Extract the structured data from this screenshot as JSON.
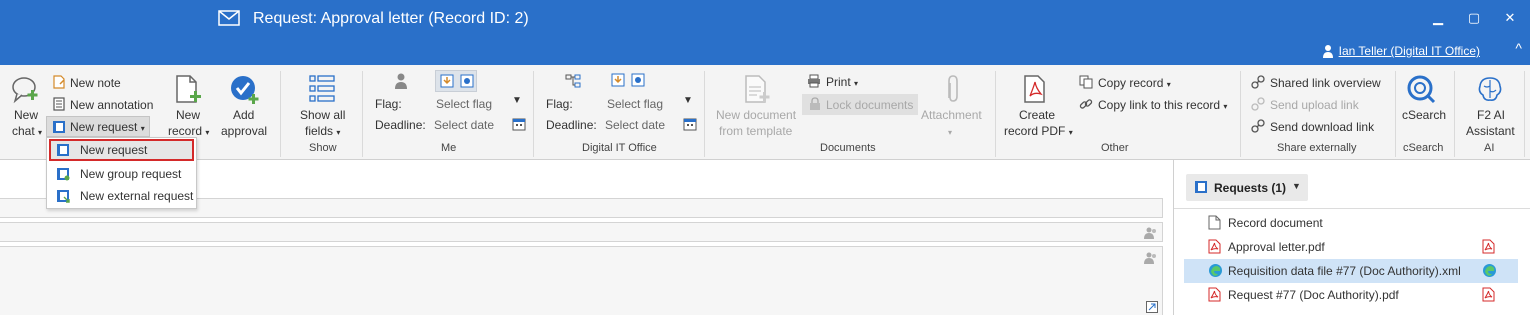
{
  "window": {
    "title": "Request: Approval letter (Record ID: 2)",
    "minimize": "▁",
    "maximize": "▢",
    "close": "✕",
    "user_link": "Ian Teller (Digital IT Office)",
    "collapse_ribbon": "^"
  },
  "ribbon": {
    "new_chat": {
      "line1": "New",
      "line2": "chat"
    },
    "new_note": "New note",
    "new_annotation": "New annotation",
    "new_request": "New request",
    "new_record": {
      "line1": "New",
      "line2": "record"
    },
    "add_approval": {
      "line1": "Add",
      "line2": "approval"
    },
    "show_all_fields": {
      "line1": "Show all",
      "line2": "fields"
    },
    "show_group": "Show",
    "me": {
      "flag_label": "Flag:",
      "flag_value": "Select flag",
      "deadline_label": "Deadline:",
      "deadline_value": "Select date",
      "group": "Me"
    },
    "digital_it_office": {
      "flag_label": "Flag:",
      "flag_value": "Select flag",
      "deadline_label": "Deadline:",
      "deadline_value": "Select date",
      "group": "Digital IT Office"
    },
    "documents": {
      "new_document_template": {
        "line1": "New document",
        "line2": "from template"
      },
      "print": "Print",
      "lock_documents": "Lock documents",
      "attachment": "Attachment",
      "group": "Documents"
    },
    "other": {
      "create_record_pdf": {
        "line1": "Create",
        "line2": "record PDF"
      },
      "copy_record": "Copy record",
      "copy_link": "Copy link to this record",
      "group": "Other"
    },
    "share_externally": {
      "shared_link_overview": "Shared link overview",
      "send_upload_link": "Send upload link",
      "send_download_link": "Send download link",
      "group": "Share externally"
    },
    "csearch": {
      "label": "cSearch",
      "group": "cSearch"
    },
    "ai": {
      "line1": "F2 AI",
      "line2": "Assistant",
      "group": "AI"
    }
  },
  "dropdown": {
    "items": [
      {
        "label": "New request",
        "selected": true
      },
      {
        "label": "New group request",
        "selected": false
      },
      {
        "label": "New external request",
        "selected": false
      }
    ]
  },
  "right_panel": {
    "header": "Requests (1)",
    "files": [
      {
        "name": "Record document",
        "type": "doc",
        "selected": false
      },
      {
        "name": "Approval letter.pdf",
        "type": "pdf",
        "selected": false
      },
      {
        "name": "Requisition data file #77 (Doc Authority).xml",
        "type": "edge",
        "selected": true
      },
      {
        "name": "Request #77 (Doc Authority).pdf",
        "type": "pdf",
        "selected": false
      }
    ]
  },
  "colors": {
    "titlebar": "#2a70c9",
    "selection_border": "#d42a2a",
    "selected_row": "#cfe3f7",
    "pdf_red": "#d42a2a",
    "icon_blue": "#2a70c9",
    "icon_green": "#5aa64a"
  }
}
